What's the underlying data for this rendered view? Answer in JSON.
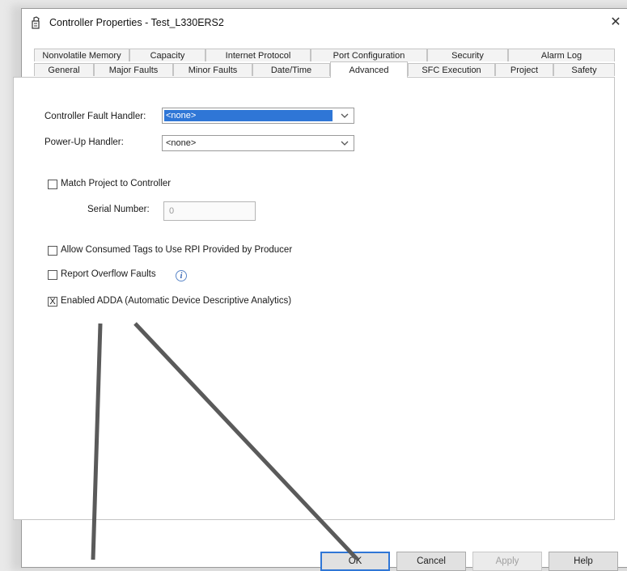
{
  "window": {
    "title": "Controller Properties - Test_L330ERS2",
    "close_glyph": "✕",
    "icon": "controller-icon"
  },
  "tabs": {
    "row1": [
      "Nonvolatile Memory",
      "Capacity",
      "Internet Protocol",
      "Port Configuration",
      "Security",
      "Alarm Log"
    ],
    "row2": [
      "General",
      "Major Faults",
      "Minor Faults",
      "Date/Time",
      "Advanced",
      "SFC Execution",
      "Project",
      "Safety"
    ],
    "active": "Advanced"
  },
  "advanced": {
    "fault_handler": {
      "label": "Controller Fault Handler:",
      "value": "<none>"
    },
    "powerup_handler": {
      "label": "Power-Up Handler:",
      "value": "<none>"
    },
    "match_project": {
      "label": "Match Project to Controller",
      "checked": false
    },
    "serial_number": {
      "label": "Serial Number:",
      "value": "0"
    },
    "allow_consumed": {
      "label": "Allow Consumed Tags to Use RPI Provided by Producer",
      "checked": false
    },
    "report_overflow": {
      "label": "Report Overflow Faults",
      "checked": false
    },
    "enabled_adda": {
      "label": "Enabled ADDA (Automatic Device Descriptive Analytics)",
      "checked": true,
      "mark": "X"
    }
  },
  "buttons": {
    "ok": "OK",
    "cancel": "Cancel",
    "apply": "Apply",
    "help": "Help"
  },
  "colors": {
    "selection": "#2f76d6",
    "callout_line": "#5a5a5a"
  }
}
